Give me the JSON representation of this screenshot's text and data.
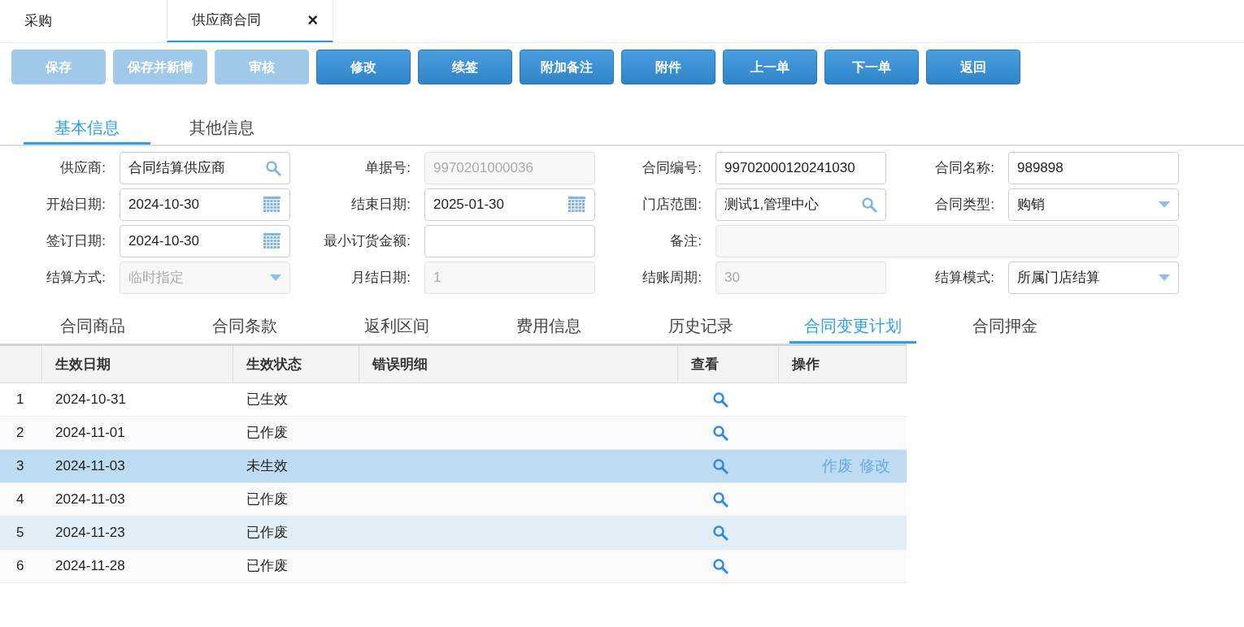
{
  "window_tabs": [
    {
      "label": "采购",
      "selected": false
    },
    {
      "label": "供应商合同",
      "selected": true,
      "close": "×"
    }
  ],
  "toolbar": [
    {
      "label": "保存",
      "disabled": true
    },
    {
      "label": "保存并新增",
      "disabled": true
    },
    {
      "label": "审核",
      "disabled": true
    },
    {
      "label": "修改",
      "disabled": false
    },
    {
      "label": "续签",
      "disabled": false
    },
    {
      "label": "附加备注",
      "disabled": false
    },
    {
      "label": "附件",
      "disabled": false
    },
    {
      "label": "上一单",
      "disabled": false
    },
    {
      "label": "下一单",
      "disabled": false
    },
    {
      "label": "返回",
      "disabled": false
    }
  ],
  "section_tabs": [
    {
      "label": "基本信息",
      "selected": true
    },
    {
      "label": "其他信息",
      "selected": false
    }
  ],
  "form": [
    {
      "label": "供应商:",
      "value": "合同结算供应商",
      "kind": "search",
      "disabled": false
    },
    {
      "label": "单据号:",
      "value": "9970201000036",
      "kind": "text",
      "disabled": true
    },
    {
      "label": "合同编号:",
      "value": "99702000120241030",
      "kind": "text",
      "disabled": false
    },
    {
      "label": "合同名称:",
      "value": "989898",
      "kind": "text",
      "disabled": false
    },
    {
      "label": "开始日期:",
      "value": "2024-10-30",
      "kind": "date",
      "disabled": false
    },
    {
      "label": "结束日期:",
      "value": "2025-01-30",
      "kind": "date",
      "disabled": false
    },
    {
      "label": "门店范围:",
      "value": "测试1,管理中心",
      "kind": "search",
      "disabled": false
    },
    {
      "label": "合同类型:",
      "value": "购销",
      "kind": "select",
      "disabled": false
    },
    {
      "label": "签订日期:",
      "value": "2024-10-30",
      "kind": "date",
      "disabled": false
    },
    {
      "label": "最小订货金额:",
      "kind": "text",
      "disabled": false
    },
    {
      "label": "备注:",
      "kind": "note",
      "disabled": true
    },
    {
      "label": "结算方式:",
      "value": "临时指定",
      "kind": "select",
      "disabled": true
    },
    {
      "label": "月结日期:",
      "value": "1",
      "kind": "text",
      "disabled": true
    },
    {
      "label": "结账周期:",
      "value": "30",
      "kind": "text",
      "disabled": true
    },
    {
      "label": "结算模式:",
      "value": "所属门店结算",
      "kind": "select",
      "disabled": false
    }
  ],
  "detail_tabs": [
    {
      "label": "合同商品",
      "selected": false
    },
    {
      "label": "合同条款",
      "selected": false
    },
    {
      "label": "返利区间",
      "selected": false
    },
    {
      "label": "费用信息",
      "selected": false
    },
    {
      "label": "历史记录",
      "selected": false
    },
    {
      "label": "合同变更计划",
      "selected": true
    },
    {
      "label": "合同押金",
      "selected": false
    }
  ],
  "table": {
    "columns": [
      "生效日期",
      "生效状态",
      "错误明细",
      "查看",
      "操作"
    ],
    "rows": [
      {
        "index": "1",
        "date": "2024-10-31",
        "status": "已生效",
        "selected": false,
        "hovered": false
      },
      {
        "index": "2",
        "date": "2024-11-01",
        "status": "已作废",
        "selected": false,
        "hovered": false
      },
      {
        "index": "3",
        "date": "2024-11-03",
        "status": "未生效",
        "selected": true,
        "hovered": false,
        "actions": [
          "作废",
          "修改"
        ]
      },
      {
        "index": "4",
        "date": "2024-11-03",
        "status": "已作废",
        "selected": false,
        "hovered": false
      },
      {
        "index": "5",
        "date": "2024-11-23",
        "status": "已作废",
        "selected": false,
        "hovered": true
      },
      {
        "index": "6",
        "date": "2024-11-28",
        "status": "已作废",
        "selected": false,
        "hovered": false
      }
    ]
  }
}
